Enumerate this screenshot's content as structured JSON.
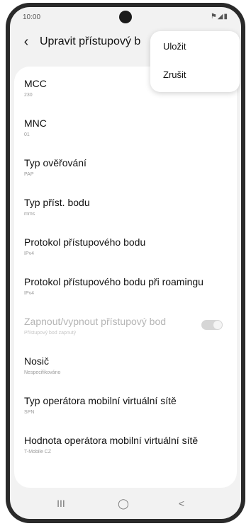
{
  "status": {
    "time": "10:00",
    "icons": "⚑◢▮"
  },
  "header": {
    "title": "Upravit přístupový b"
  },
  "menu": {
    "items": [
      "Uložit",
      "Zrušit"
    ]
  },
  "settings": [
    {
      "title": "MCC",
      "value": "230"
    },
    {
      "title": "MNC",
      "value": "01"
    },
    {
      "title": "Typ ověřování",
      "value": "PAP"
    },
    {
      "title": "Typ příst. bodu",
      "value": "mms"
    },
    {
      "title": "Protokol přístupového bodu",
      "value": "IPv4"
    },
    {
      "title": "Protokol přístupového bodu při roamingu",
      "value": "IPv4"
    },
    {
      "title": "Zapnout/vypnout přístupový bod",
      "value": "Přístupový bod zapnutý",
      "disabled": true,
      "toggle": "on"
    },
    {
      "title": "Nosič",
      "value": "Nespecifikováno"
    },
    {
      "title": "Typ operátora mobilní virtuální sítě",
      "value": "SPN"
    },
    {
      "title": "Hodnota operátora mobilní virtuální sítě",
      "value": "T-Mobile CZ"
    }
  ],
  "navbar": {
    "recents": "III",
    "home": "◯",
    "back": "<"
  }
}
